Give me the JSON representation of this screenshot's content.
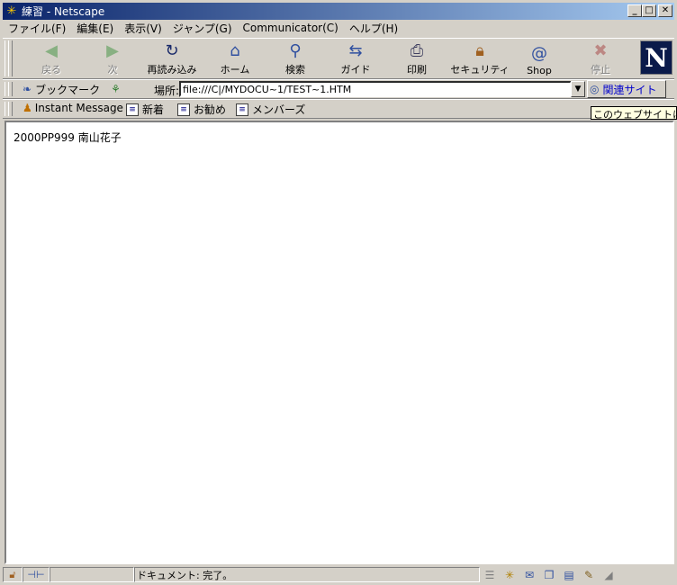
{
  "window": {
    "title": "練習 - Netscape",
    "title_icon": "netscape-star-icon"
  },
  "title_buttons": {
    "minimize": "_",
    "maximize": "□",
    "close": "✕"
  },
  "menu": [
    "ファイル(F)",
    "編集(E)",
    "表示(V)",
    "ジャンプ(G)",
    "Communicator(C)",
    "ヘルプ(H)"
  ],
  "nav": {
    "back": "戻る",
    "forward": "次",
    "reload": "再読み込み",
    "home": "ホーム",
    "search": "検索",
    "guide": "ガイド",
    "print": "印刷",
    "security": "セキュリティ",
    "shop": "Shop",
    "stop": "停止"
  },
  "location": {
    "bookmarks_label": "ブックマーク",
    "label": "場所:",
    "url": "file:///C|/MYDOCU~1/TEST~1.HTM",
    "related_label": "関連サイト"
  },
  "personal": {
    "instant_message": "Instant Message",
    "new": "新着",
    "recommend": "お勧め",
    "members": "メンバーズ"
  },
  "tooltip": "このウェブサイトに関",
  "content": {
    "text": "2000PP999 南山花子"
  },
  "status": {
    "text": "ドキュメント: 完了。"
  },
  "logo": "N",
  "colors": {
    "titlebar_start": "#0a246a",
    "titlebar_end": "#a6caf0",
    "chrome": "#d4d0c8"
  }
}
